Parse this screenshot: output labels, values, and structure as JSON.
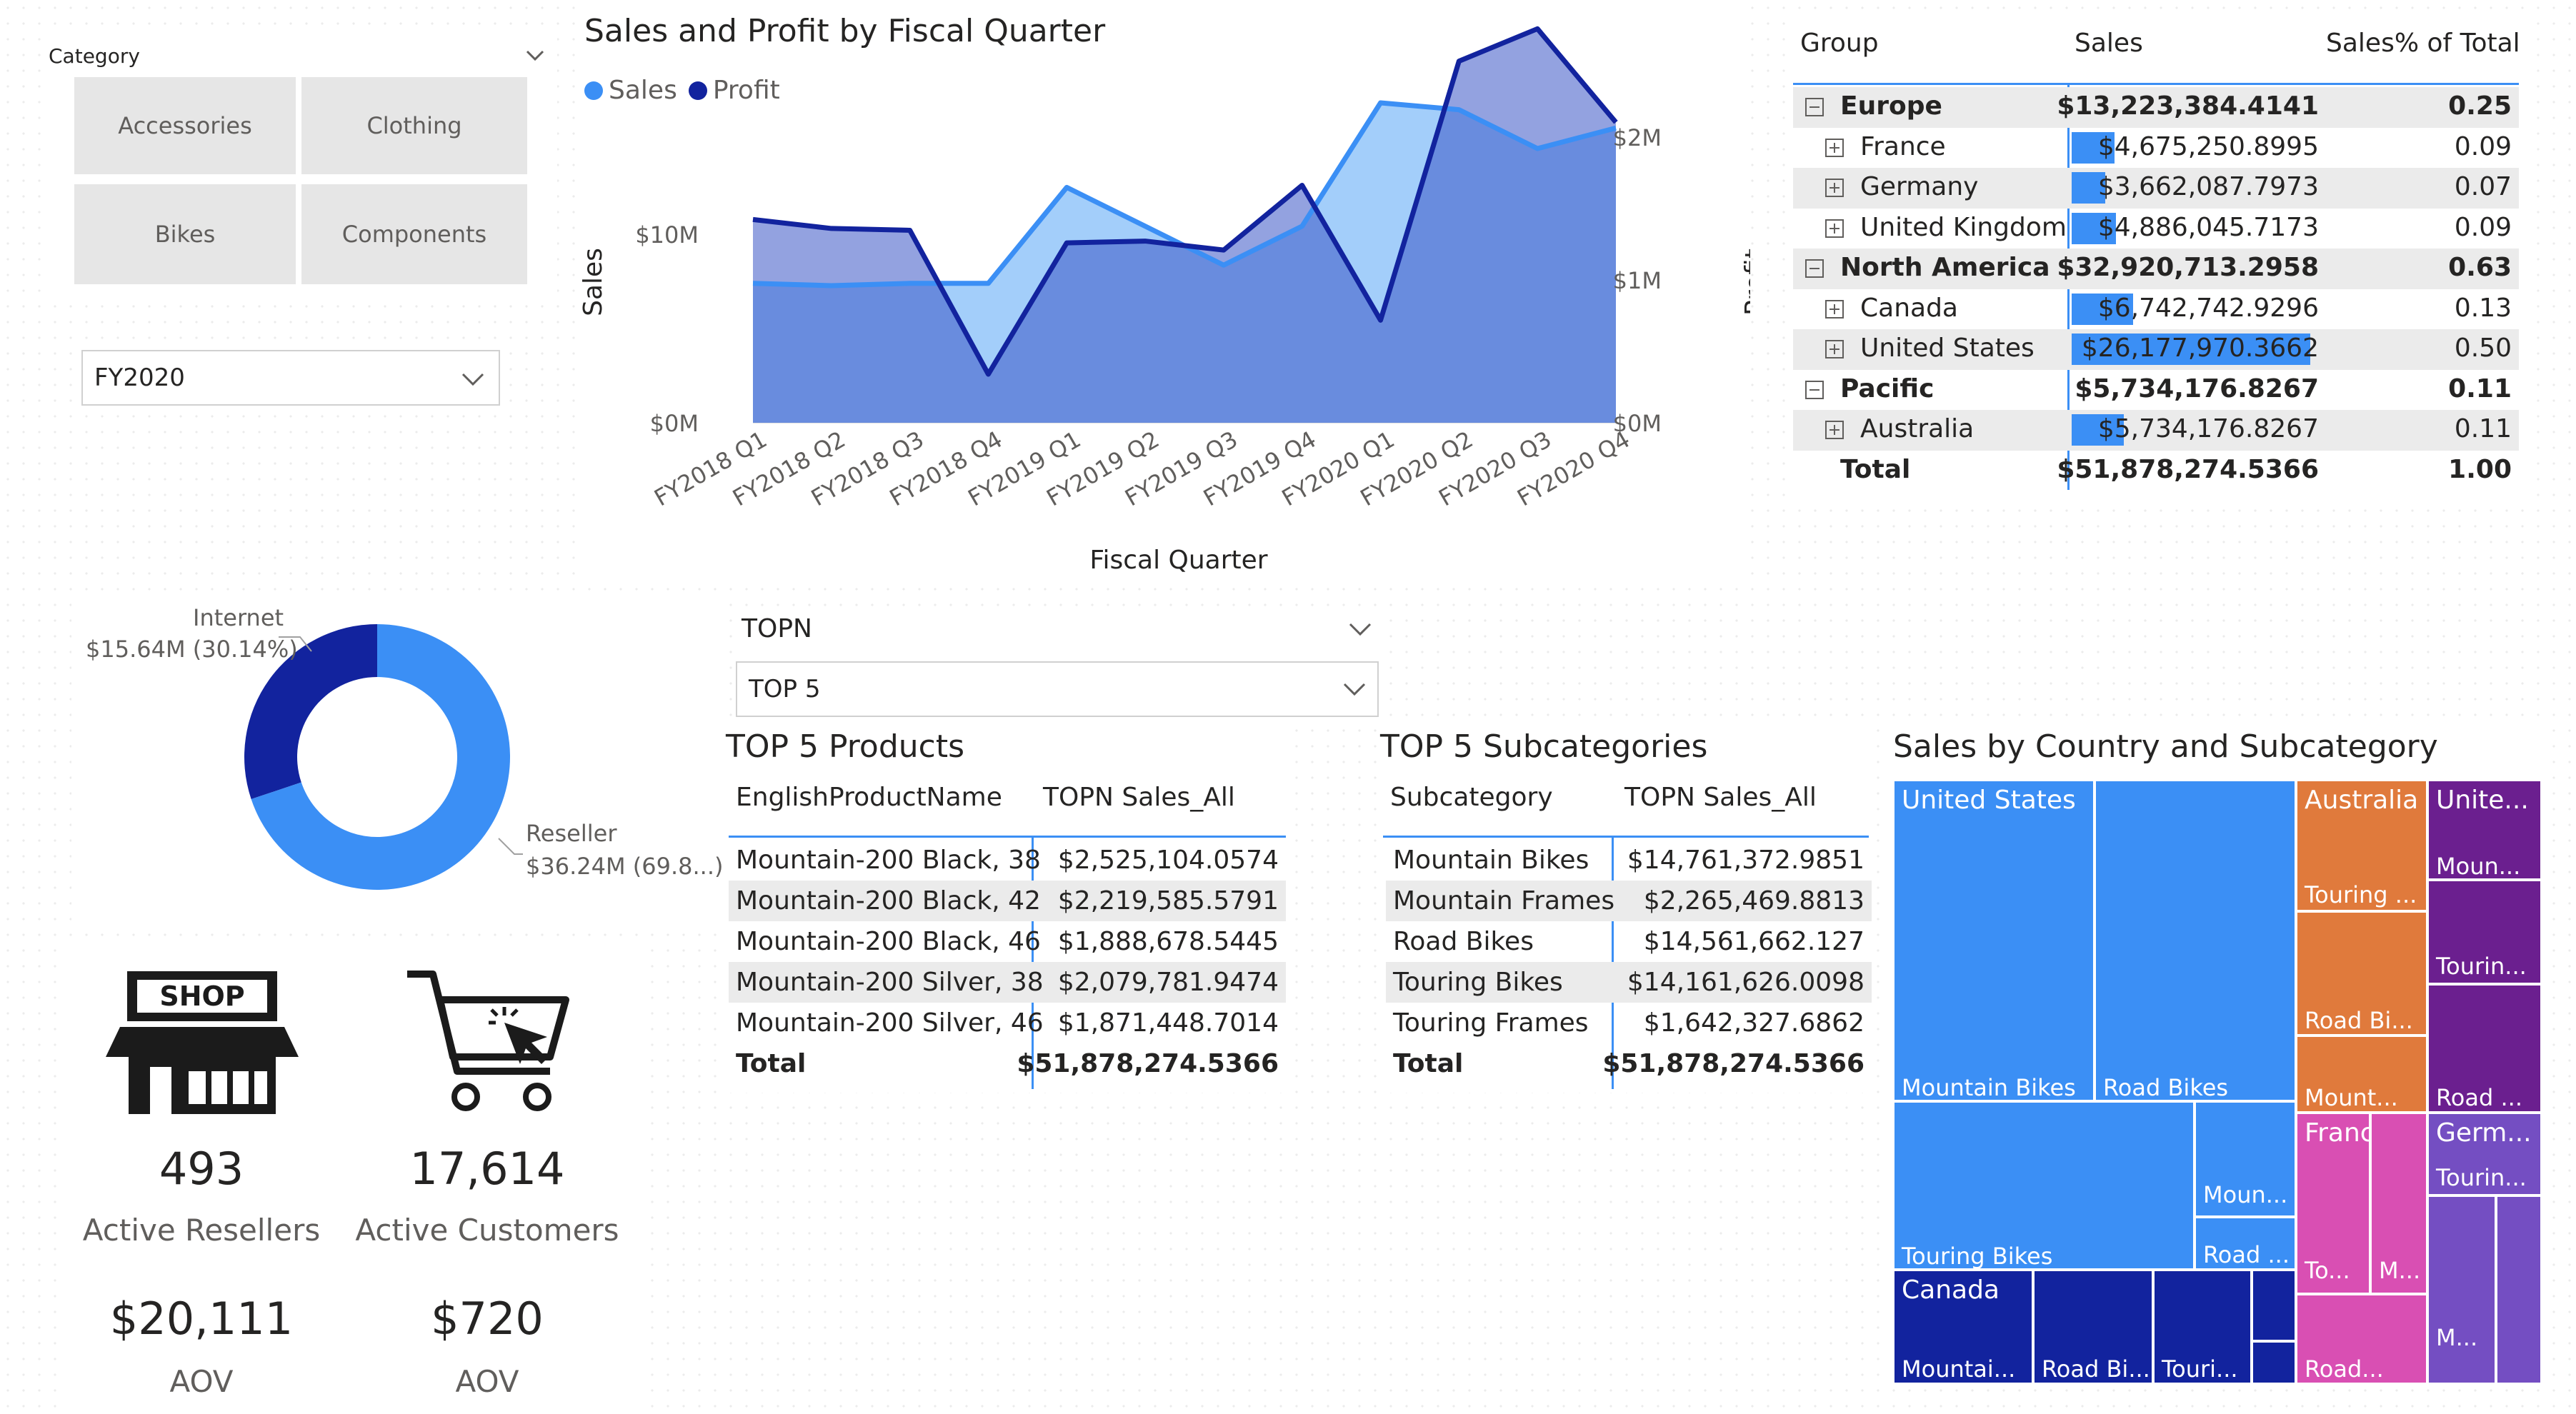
{
  "slicer": {
    "title": "Category",
    "buttons": [
      "Accessories",
      "Clothing",
      "Bikes",
      "Components"
    ],
    "fiscal_year": "FY2020"
  },
  "line_chart": {
    "title": "Sales and Profit by Fiscal Quarter",
    "legend": [
      "Sales",
      "Profit"
    ],
    "ylabel": "Sales",
    "y2label": "Profit",
    "xlabel": "Fiscal Quarter",
    "y_ticks": [
      "$0M",
      "$10M"
    ],
    "y2_ticks": [
      "$0M",
      "$1M",
      "$2M"
    ]
  },
  "chart_data": {
    "type": "area",
    "title": "Sales and Profit by Fiscal Quarter",
    "xlabel": "Fiscal Quarter",
    "ylabel": "Sales",
    "y2label": "Profit",
    "categories": [
      "FY2018 Q1",
      "FY2018 Q2",
      "FY2018 Q3",
      "FY2018 Q4",
      "FY2019 Q1",
      "FY2019 Q2",
      "FY2019 Q3",
      "FY2019 Q4",
      "FY2020 Q1",
      "FY2020 Q2",
      "FY2020 Q3",
      "FY2020 Q4"
    ],
    "ylim": [
      0,
      18500000
    ],
    "y2lim": [
      0,
      2350000
    ],
    "series": [
      {
        "name": "Sales",
        "axis": "left",
        "color": "#3b8ff5",
        "values": [
          6100000,
          6000000,
          6100000,
          6100000,
          10300000,
          8600000,
          6900000,
          8600000,
          14000000,
          13700000,
          12000000,
          12900000
        ]
      },
      {
        "name": "Profit",
        "axis": "right",
        "color": "#12239e",
        "values": [
          1130000,
          1080000,
          1070000,
          270000,
          1000000,
          1010000,
          960000,
          1320000,
          570000,
          2010000,
          2190000,
          1670000
        ]
      }
    ]
  },
  "matrix": {
    "headers": [
      "Group",
      "Sales",
      "Sales% of Total"
    ],
    "rows": [
      {
        "label": "Europe",
        "sales": "$13,223,384.4141",
        "pct": "0.25",
        "level": 0
      },
      {
        "label": "France",
        "sales": "$4,675,250.8995",
        "pct": "0.09",
        "level": 1
      },
      {
        "label": "Germany",
        "sales": "$3,662,087.7973",
        "pct": "0.07",
        "level": 1
      },
      {
        "label": "United Kingdom",
        "sales": "$4,886,045.7173",
        "pct": "0.09",
        "level": 1
      },
      {
        "label": "North America",
        "sales": "$32,920,713.2958",
        "pct": "0.63",
        "level": 0
      },
      {
        "label": "Canada",
        "sales": "$6,742,742.9296",
        "pct": "0.13",
        "level": 1
      },
      {
        "label": "United States",
        "sales": "$26,177,970.3662",
        "pct": "0.50",
        "level": 1
      },
      {
        "label": "Pacific",
        "sales": "$5,734,176.8267",
        "pct": "0.11",
        "level": 0
      },
      {
        "label": "Australia",
        "sales": "$5,734,176.8267",
        "pct": "0.11",
        "level": 1
      }
    ],
    "total": {
      "label": "Total",
      "sales": "$51,878,274.5366",
      "pct": "1.00"
    }
  },
  "donut": {
    "internet_label": "Internet",
    "internet_value": "$15.64M (30.14%)",
    "internet_pct": 30.14,
    "reseller_label": "Reseller",
    "reseller_value": "$36.24M (69.8...)",
    "reseller_pct": 69.86
  },
  "topn": {
    "title": "TOPN",
    "selected": "TOP 5"
  },
  "top_products": {
    "title": "TOP 5 Products",
    "headers": [
      "EnglishProductName",
      "TOPN Sales_All"
    ],
    "rows": [
      [
        "Mountain-200 Black, 38",
        "$2,525,104.0574"
      ],
      [
        "Mountain-200 Black, 42",
        "$2,219,585.5791"
      ],
      [
        "Mountain-200 Black, 46",
        "$1,888,678.5445"
      ],
      [
        "Mountain-200 Silver, 38",
        "$2,079,781.9474"
      ],
      [
        "Mountain-200 Silver, 46",
        "$1,871,448.7014"
      ]
    ],
    "total": [
      "Total",
      "$51,878,274.5366"
    ]
  },
  "top_subcategories": {
    "title": "TOP 5 Subcategories",
    "headers": [
      "Subcategory",
      "TOPN Sales_All"
    ],
    "rows": [
      [
        "Mountain Bikes",
        "$14,761,372.9851"
      ],
      [
        "Mountain Frames",
        "$2,265,469.8813"
      ],
      [
        "Road Bikes",
        "$14,561,662.127"
      ],
      [
        "Touring Bikes",
        "$14,161,626.0098"
      ],
      [
        "Touring Frames",
        "$1,642,327.6862"
      ]
    ],
    "total": [
      "Total",
      "$51,878,274.5366"
    ]
  },
  "kpis": {
    "resellers_value": "493",
    "resellers_label": "Active Resellers",
    "customers_value": "17,614",
    "customers_label": "Active Customers",
    "aov_reseller": "$20,111",
    "aov_customer": "$720",
    "aov_label": "AOV",
    "shop_sign": "SHOP"
  },
  "treemap": {
    "title": "Sales by Country and Subcategory",
    "colors": {
      "us": "#3b8ff5",
      "canada": "#12239e",
      "australia": "#e07a3c",
      "unitedkingdom": "#6b1f8f",
      "france": "#d94fb3",
      "germany": "#744ec2"
    },
    "labels": {
      "us": "United States",
      "us_mb": "Mountain Bikes",
      "us_rb": "Road Bikes",
      "us_tb": "Touring Bikes",
      "us_moun": "Moun...",
      "us_road": "Road ...",
      "aus": "Australia",
      "aus_touring": "Touring ...",
      "aus_road": "Road Bi...",
      "aus_mount": "Mount...",
      "uk": "Unite...",
      "uk_moun": "Moun...",
      "uk_tour": "Tourin...",
      "uk_road": "Road ...",
      "canada": "Canada",
      "canada_mount": "Mountai...",
      "canada_road": "Road Bi...",
      "canada_tour": "Touri...",
      "france": "France",
      "france_to": "To...",
      "france_m": "M...",
      "france_road": "Road...",
      "germany": "Germ...",
      "germany_tour": "Tourin...",
      "germany_m": "M..."
    }
  }
}
